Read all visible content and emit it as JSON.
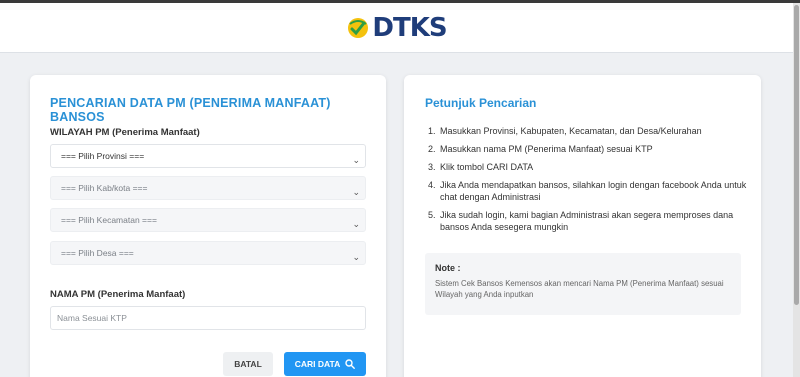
{
  "header": {
    "logo_text": "DTKS"
  },
  "search_card": {
    "title": "PENCARIAN DATA PM (PENERIMA MANFAAT) BANSOS",
    "region_label": "WILAYAH PM (Penerima Manfaat)",
    "selects": {
      "province": "=== Pilih Provinsi ===",
      "city": "=== Pilih Kab/kota ===",
      "district": "=== Pilih Kecamatan ===",
      "village": "=== Pilih Desa ==="
    },
    "name_label": "NAMA PM (Penerima Manfaat)",
    "name_placeholder": "Nama Sesuai KTP",
    "cancel_label": "BATAL",
    "search_label": "CARI DATA"
  },
  "help_card": {
    "title": "Petunjuk Pencarian",
    "steps": [
      {
        "num": "1.",
        "text": "Masukkan Provinsi, Kabupaten, Kecamatan, dan Desa/Kelurahan"
      },
      {
        "num": "2.",
        "text": "Masukkan nama PM (Penerima Manfaat) sesuai KTP"
      },
      {
        "num": "3.",
        "text": "Klik tombol CARI DATA"
      },
      {
        "num": "4.",
        "text": "Jika Anda mendapatkan bansos, silahkan login dengan facebook Anda untuk chat dengan Administrasi"
      },
      {
        "num": "5.",
        "text": "Jika sudah login, kami bagian Administrasi akan segera memproses dana bansos Anda sesegera mungkin"
      }
    ],
    "note_title": "Note :",
    "note_text": "Sistem Cek Bansos Kemensos akan mencari Nama PM (Penerima Manfaat) sesuai Wilayah yang Anda inputkan"
  },
  "colors": {
    "accent": "#2a91d6",
    "button": "#2196f3",
    "logo": "#1f3d7a"
  },
  "icons": {
    "select_arrow": "chevron-down-icon",
    "search_button": "search-icon"
  }
}
